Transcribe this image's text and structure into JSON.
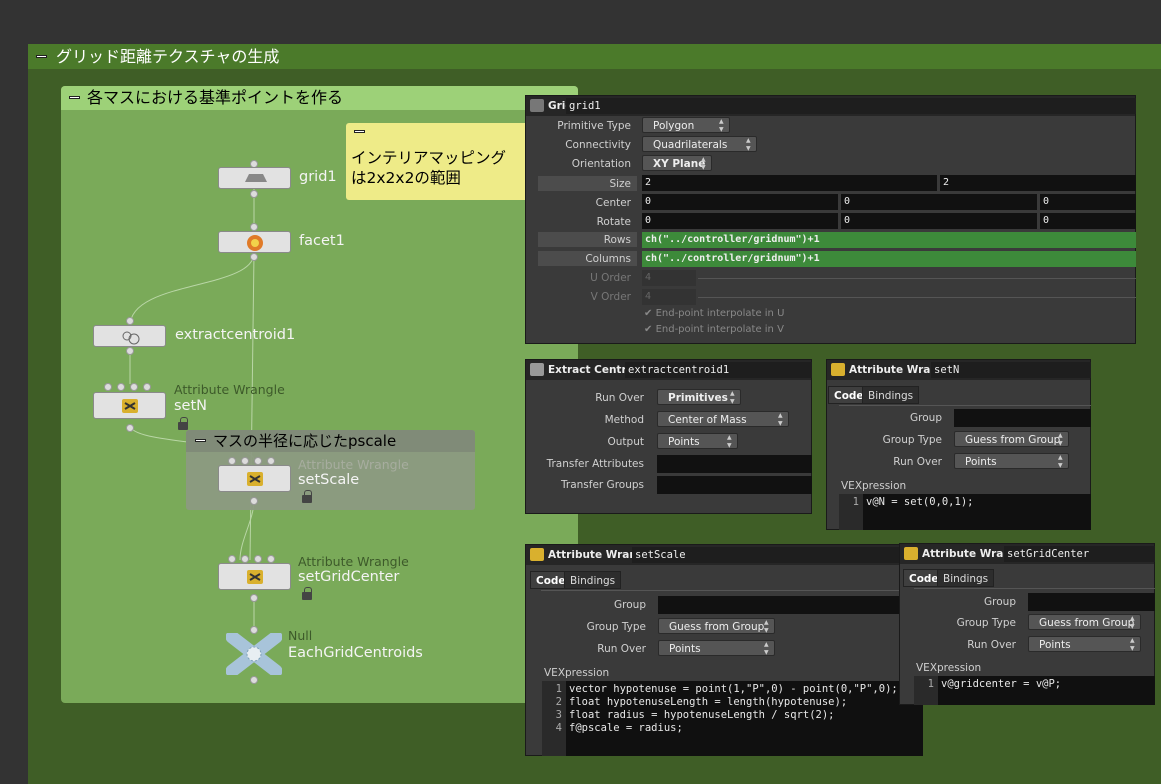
{
  "network": {
    "outer_box_title": "グリッド距離テクスチャの生成",
    "inner_box_title": "各マスにおける基準ポイントを作る",
    "scale_box_title": "マスの半径に応じたpscale",
    "sticky_note": "インテリアマッピング\nは2x2x2の範囲",
    "nodes": [
      {
        "name": "grid1",
        "type": "",
        "icon": "grid-icon"
      },
      {
        "name": "facet1",
        "type": "",
        "icon": "facet-icon"
      },
      {
        "name": "extractcentroid1",
        "type": "",
        "icon": "extract-centroid-icon"
      },
      {
        "name": "setN",
        "type": "Attribute Wrangle",
        "icon": "wrangle-icon"
      },
      {
        "name": "setScale",
        "type": "Attribute Wrangle",
        "icon": "wrangle-icon"
      },
      {
        "name": "setGridCenter",
        "type": "Attribute Wrangle",
        "icon": "wrangle-icon"
      },
      {
        "name": "EachGridCentroids",
        "type": "Null",
        "icon": "null-icon"
      }
    ]
  },
  "grid_panel": {
    "type": "Grid",
    "name": "grid1",
    "primitive_type": {
      "label": "Primitive Type",
      "value": "Polygon"
    },
    "connectivity": {
      "label": "Connectivity",
      "value": "Quadrilaterals"
    },
    "orientation": {
      "label": "Orientation",
      "value": "XY Plane"
    },
    "size": {
      "label": "Size",
      "values": [
        "2",
        "2"
      ]
    },
    "center": {
      "label": "Center",
      "values": [
        "0",
        "0",
        "0"
      ]
    },
    "rotate": {
      "label": "Rotate",
      "values": [
        "0",
        "0",
        "0"
      ]
    },
    "rows": {
      "label": "Rows",
      "value": "ch(\"../controller/gridnum\")+1"
    },
    "columns": {
      "label": "Columns",
      "value": "ch(\"../controller/gridnum\")+1"
    },
    "u_order": {
      "label": "U Order",
      "value": "4"
    },
    "v_order": {
      "label": "V Order",
      "value": "4"
    },
    "interp_u": "End-point interpolate in U",
    "interp_v": "End-point interpolate in V"
  },
  "extract_panel": {
    "type": "Extract Centroid",
    "name": "extractcentroid1",
    "run_over": {
      "label": "Run Over",
      "value": "Primitives"
    },
    "method": {
      "label": "Method",
      "value": "Center of Mass"
    },
    "output": {
      "label": "Output",
      "value": "Points"
    },
    "transfer_attributes": {
      "label": "Transfer Attributes",
      "value": ""
    },
    "transfer_groups": {
      "label": "Transfer Groups",
      "value": ""
    }
  },
  "setn_panel": {
    "type": "Attribute Wrangle",
    "name": "setN",
    "tabs": [
      "Code",
      "Bindings"
    ],
    "group": {
      "label": "Group",
      "value": ""
    },
    "group_type": {
      "label": "Group Type",
      "value": "Guess from Group"
    },
    "run_over": {
      "label": "Run Over",
      "value": "Points"
    },
    "vex_label": "VEXpression",
    "code": [
      "v@N = set(0,0,1);"
    ]
  },
  "setscale_panel": {
    "type": "Attribute Wrangle",
    "name": "setScale",
    "tabs": [
      "Code",
      "Bindings"
    ],
    "group": {
      "label": "Group",
      "value": ""
    },
    "group_type": {
      "label": "Group Type",
      "value": "Guess from Group"
    },
    "run_over": {
      "label": "Run Over",
      "value": "Points"
    },
    "vex_label": "VEXpression",
    "code": [
      "vector hypotenuse = point(1,\"P\",0) - point(0,\"P\",0);",
      "float hypotenuseLength = length(hypotenuse);",
      "float radius = hypotenuseLength / sqrt(2);",
      "f@pscale = radius;"
    ]
  },
  "setgridcenter_panel": {
    "type": "Attribute Wrangle",
    "name": "setGridCenter",
    "tabs": [
      "Code",
      "Bindings"
    ],
    "group": {
      "label": "Group",
      "value": ""
    },
    "group_type": {
      "label": "Group Type",
      "value": "Guess from Group"
    },
    "run_over": {
      "label": "Run Over",
      "value": "Points"
    },
    "vex_label": "VEXpression",
    "code": [
      "v@gridcenter = v@P;"
    ]
  },
  "colors": {
    "network_bg": "#3f5e26",
    "box_green": "#7aaa59",
    "sticky_yellow": "#eeeb88",
    "expression_green": "#3d8a3a",
    "wrangle_icon": "#d9b02e",
    "null_icon": "#a8c4da"
  }
}
